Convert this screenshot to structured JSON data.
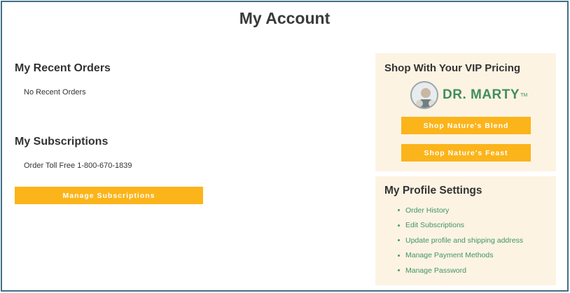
{
  "page": {
    "title": "My Account"
  },
  "recent_orders": {
    "title": "My Recent Orders",
    "empty_text": "No Recent Orders"
  },
  "subscriptions": {
    "title": "My Subscriptions",
    "phone_text": "Order Toll Free 1-800-670-1839",
    "manage_button": "Manage Subscriptions"
  },
  "vip": {
    "title": "Shop With Your VIP Pricing",
    "brand_name": "DR. MARTY",
    "brand_tm": "TM",
    "buttons": [
      "Shop Nature's Blend",
      "Shop Nature's Feast"
    ]
  },
  "profile": {
    "title": "My Profile Settings",
    "links": [
      "Order History",
      "Edit Subscriptions",
      "Update profile and shipping address",
      "Manage Payment Methods",
      "Manage Password"
    ]
  },
  "colors": {
    "accent": "#fbb41a",
    "panel_bg": "#fdf3e3",
    "link": "#3f9467",
    "frame_border": "#3f6f86"
  }
}
